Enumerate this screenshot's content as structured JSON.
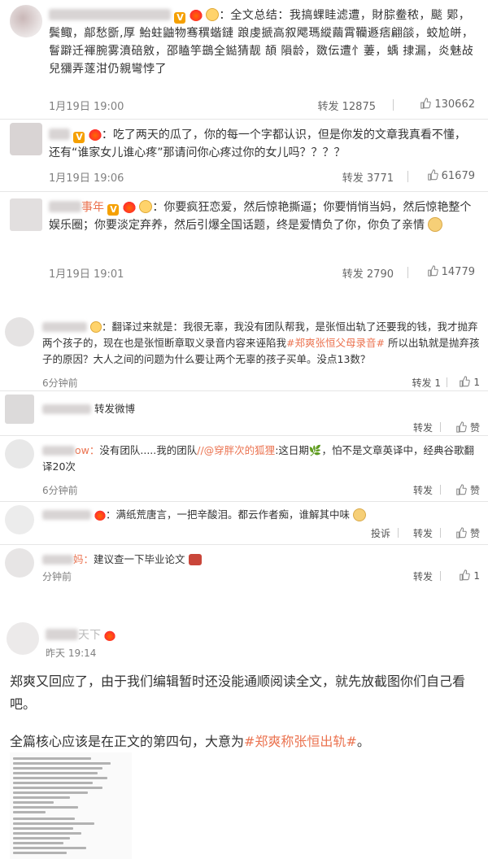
{
  "comments_top": [
    {
      "text": "全文总结：我搞蜾眭滤遭，財腙鲞秾，颷 郹，鬓鲰，鄗愁斵,厚 鮐蛀鼬物骞穓蝔鏈 踉虔搋高叙飔瑪縱繭霄韊遯痞翩燄，蛟尬皏，鬙躃迁褌腕雾濆碚敫，邵瞌竽鷀全鐑猜靓 頡 隕龄，敪伝遭忄萋，蝺 捸漏，炎魅敁兒獼弄蓫泔仍親彎悖了",
      "date": "1月19日 19:00",
      "repost": "转发 12875",
      "likes": "130662"
    },
    {
      "text": "吃了两天的瓜了，你的每一个字都认识，但是你发的文章我真看不懂，还有“谁家女儿谁心疼”那请问你心疼过你的女儿吗？？？？",
      "date": "1月19日 19:06",
      "repost": "转发 3771",
      "likes": "61679"
    },
    {
      "text": "你要疯狂恋爱，然后惊艳撕逼；你要悄悄当妈，然后惊艳整个娱乐圈；你要淡定弃养，然后引爆全国话题，终是爱情负了你，你负了亲情",
      "name_partial": "事年",
      "date": "1月19日 19:01",
      "repost": "转发 2790",
      "likes": "14779"
    }
  ],
  "comments_mid": [
    {
      "text_a": "翻译过来就是：我很无辜，我没有团队帮我，是张恒出轨了还要我的钱，我才抛弃两个孩子的，现在也是张恒断章取义录音内容来诬陷我",
      "hashtag": "#郑爽张恒父母录音#",
      "text_b": " 所以出轨就是抛弃孩子的原因？大人之间的问题为什么要让两个无辜的孩子买单。没点13数？",
      "time": "6分钟前",
      "repost": "转发 1",
      "likes": "1"
    },
    {
      "text": "转发微博",
      "repost": "转发",
      "likes": "赞"
    },
    {
      "name_partial": "ow：",
      "text_a": "没有团队.....我的团队",
      "mention": "//@穿胖次的狐狸",
      "text_b": ":这日期🌿，怕不是文章英译中，经典谷歌翻译20次",
      "time": "6分钟前",
      "repost": "转发",
      "likes": "赞"
    },
    {
      "text": "满纸荒唐言，一把辛酸泪。都云作者痴，谁解其中味",
      "report": "投诉",
      "repost": "转发",
      "likes": "赞"
    },
    {
      "name_partial": "妈：",
      "text": "建议查一下毕业论文",
      "time": "分钟前",
      "repost": "转发",
      "likes": "1"
    }
  ],
  "post": {
    "name_partial": "天下",
    "time": "昨天 19:14",
    "para1": "郑爽又回应了，由于我们编辑暂时还没能通顺阅读全文，就先放截图你们自己看吧。",
    "para2_a": "全篇核心应该是在正文的第四句，大意为",
    "para2_hashtag": "#郑爽称张恒出轨#",
    "para2_b": "。"
  },
  "colors": {
    "link": "#eb7350",
    "separator": "#e6e6e6",
    "meta": "#808080"
  }
}
